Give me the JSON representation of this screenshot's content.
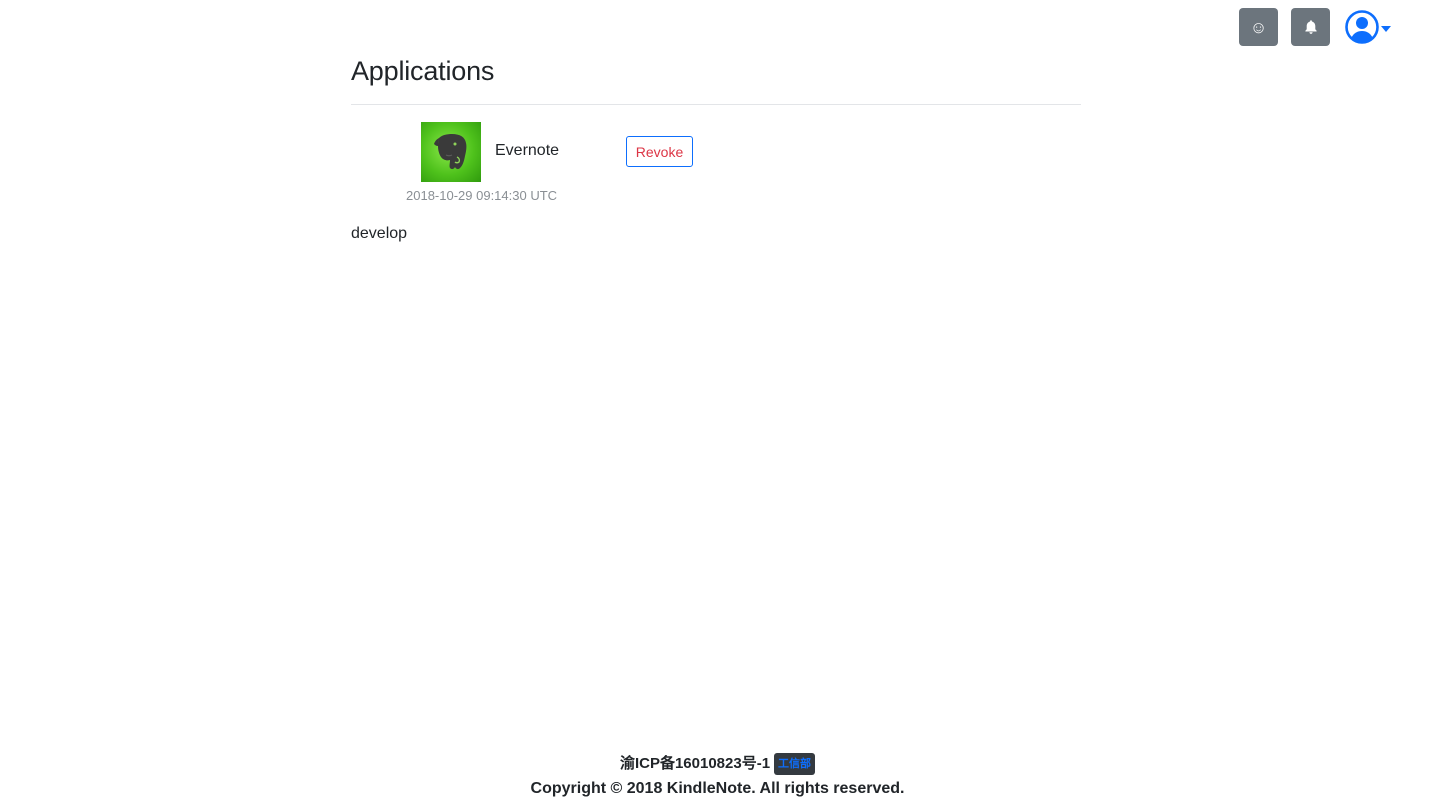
{
  "header": {
    "emoji_button_glyph": "☺",
    "notification_icon": "bell-icon",
    "user_icon": "user-circle-icon",
    "accent_color": "#0d6efd"
  },
  "main": {
    "title": "Applications",
    "applications": [
      {
        "name": "Evernote",
        "icon": "evernote-elephant-icon",
        "revoke_label": "Revoke",
        "authorized_at": "2018-10-29 09:14:30 UTC"
      }
    ],
    "environment": "develop"
  },
  "footer": {
    "icp": "渝ICP备16010823号-1",
    "icp_badge": "工信部",
    "copyright": "Copyright © 2018 KindleNote. All rights reserved."
  }
}
